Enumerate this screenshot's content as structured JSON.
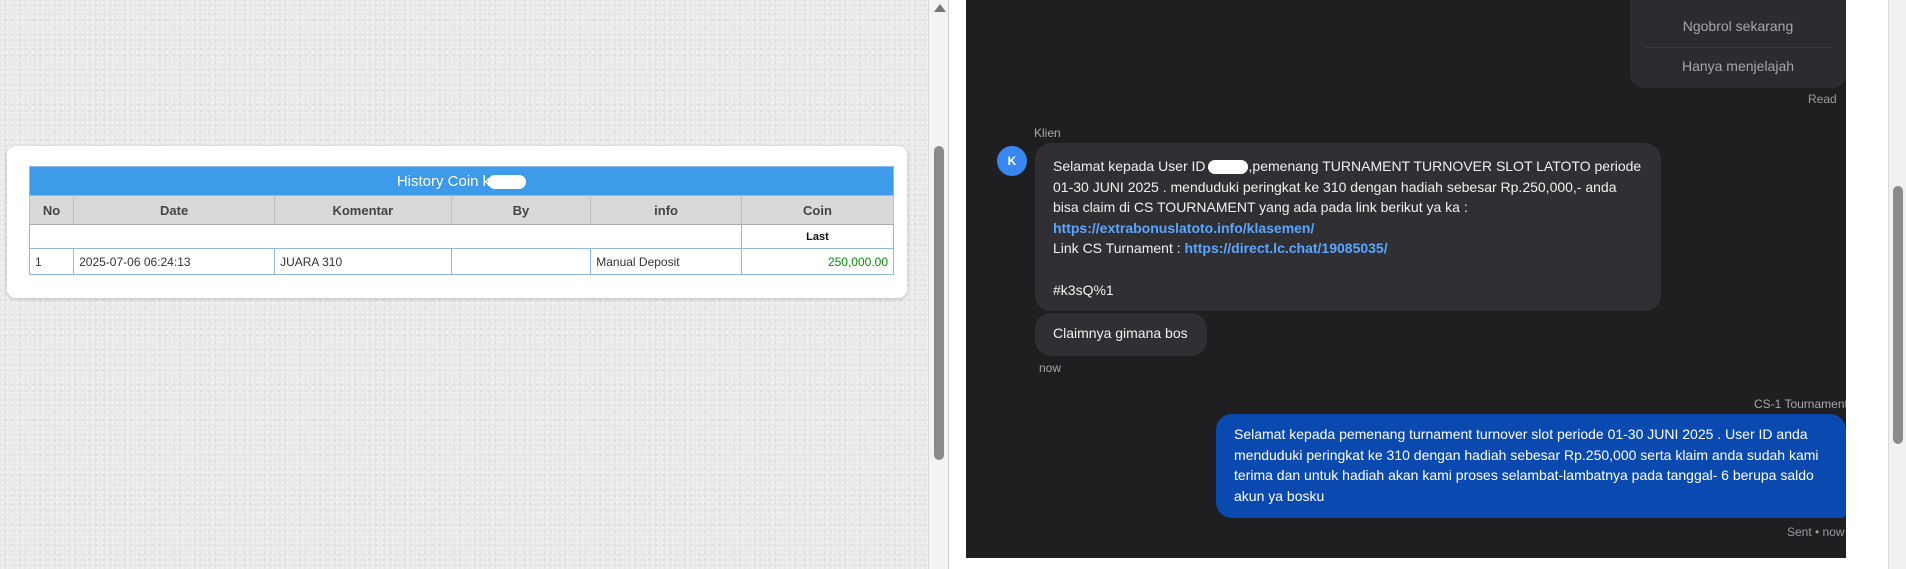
{
  "history": {
    "title": "History Coin k",
    "columns": [
      "No",
      "Date",
      "Komentar",
      "By",
      "info",
      "Coin"
    ],
    "sub_header": "Last",
    "rows": [
      {
        "no": "1",
        "date": "2025-07-06 06:24:13",
        "komentar": "JUARA 310",
        "by": "",
        "info": "Manual Deposit",
        "coin": "250,000.00"
      }
    ]
  },
  "chat": {
    "options": [
      "Ngobrol sekarang",
      "Hanya menjelajah"
    ],
    "read_label": "Read",
    "client": {
      "name": "Klien",
      "avatar_initial": "K",
      "message_lines": {
        "l1a": "Selamat kepada User ID",
        "l1b": ",pemenang TURNAMENT TURNOVER SLOT LATOTO periode",
        "l2": "01-30 JUNI 2025 . menduduki peringkat ke 310 dengan hadiah sebesar Rp.250,000,- anda",
        "l3": "bisa claim di CS TOURNAMENT yang ada pada link berikut ya ka :",
        "link1": "https://extrabonuslatoto.info/klasemen/",
        "l5_prefix": "Link CS Turnament : ",
        "link2": "https://direct.lc.chat/19085035/",
        "code": "#k3sQ%1"
      },
      "message_2": "Claimnya gimana bos",
      "time": "now"
    },
    "agent": {
      "name": "CS-1 Tournament",
      "message_lines": [
        "Selamat kepada pemenang turnament turnover slot periode 01-30 JUNI 2025 . User ID anda",
        "menduduki peringkat ke 310 dengan hadiah sebesar Rp.250,000 serta klaim anda sudah kami",
        "terima dan untuk hadiah akan kami proses selambat-lambatnya pada tanggal- 6 berupa saldo",
        "akun ya bosku"
      ],
      "status": "Sent • now"
    }
  },
  "colors": {
    "table_title_bg": "#3d9be9",
    "coin_value": "#0a8a0a",
    "chat_bg": "#1f1f21",
    "client_bubble": "#303034",
    "agent_bubble": "#0a49b0",
    "link": "#5aa6ff",
    "avatar": "#3a86f0"
  }
}
